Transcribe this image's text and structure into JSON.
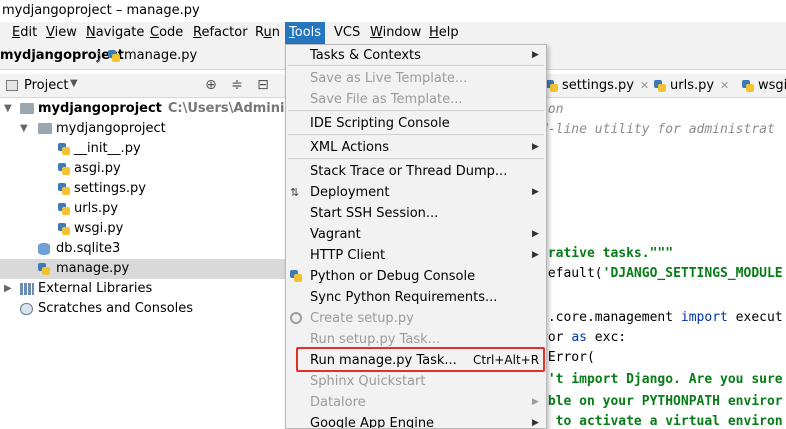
{
  "window": {
    "title": "mydjangoproject – manage.py"
  },
  "menu": [
    {
      "label": "Edit",
      "u": "E",
      "rest": "dit"
    },
    {
      "label": "View",
      "u": "V",
      "rest": "iew"
    },
    {
      "label": "Navigate",
      "u": "N",
      "rest": "avigate"
    },
    {
      "label": "Code",
      "u": "C",
      "rest": "ode"
    },
    {
      "label": "Refactor",
      "u": "R",
      "rest": "efactor"
    },
    {
      "label": "Run",
      "pre": "R",
      "u": "u",
      "rest": "n"
    },
    {
      "label": "Tools",
      "u": "T",
      "rest": "ools"
    },
    {
      "label": "VCS",
      "u": "",
      "rest": "VCS"
    },
    {
      "label": "Window",
      "u": "W",
      "rest": "indow"
    },
    {
      "label": "Help",
      "u": "H",
      "rest": "elp"
    }
  ],
  "breadcrumb": {
    "project": "mydjangoproject",
    "separator": "〉",
    "file": "manage.py"
  },
  "project_panel": {
    "title": "Project",
    "tree": [
      {
        "label": "mydjangoproject",
        "path": "C:\\Users\\Administrator",
        "icon": "folder-icon",
        "bold": true
      },
      {
        "label": "mydjangoproject",
        "icon": "folder-icon"
      },
      {
        "label": "__init__.py",
        "icon": "python-file-icon"
      },
      {
        "label": "asgi.py",
        "icon": "python-file-icon"
      },
      {
        "label": "settings.py",
        "icon": "python-file-icon"
      },
      {
        "label": "urls.py",
        "icon": "python-file-icon"
      },
      {
        "label": "wsgi.py",
        "icon": "python-file-icon"
      },
      {
        "label": "db.sqlite3",
        "icon": "database-icon"
      },
      {
        "label": "manage.py",
        "icon": "python-file-icon",
        "selected": true
      },
      {
        "label": "External Libraries",
        "icon": "library-icon"
      },
      {
        "label": "Scratches and Consoles",
        "icon": "scratches-icon"
      }
    ]
  },
  "tabs": [
    {
      "label": "settings.py"
    },
    {
      "label": "urls.py"
    },
    {
      "label": "wsgi"
    }
  ],
  "editor": {
    "lines": [
      {
        "parts": [
          [
            "cmt",
            "hon"
          ]
        ]
      },
      {
        "parts": [
          [
            "cmt",
            "d-line utility for administrat"
          ]
        ]
      },
      {
        "parts": [
          [
            "str",
            "trative tasks.\"\"\""
          ]
        ]
      },
      {
        "parts": [
          [
            "nrm",
            "default("
          ],
          [
            "str",
            "'DJANGO_SETTINGS_MODULE"
          ]
        ]
      },
      {
        "parts": [
          [
            "nrm",
            "o.core.management "
          ],
          [
            "kw",
            "import"
          ],
          [
            "nrm",
            " execut"
          ]
        ]
      },
      {
        "parts": [
          [
            "nrm",
            "ror "
          ],
          [
            "kw",
            "as"
          ],
          [
            "nrm",
            " exc:"
          ]
        ]
      },
      {
        "parts": [
          [
            "nrm",
            "tError("
          ]
        ]
      },
      {
        "parts": [
          [
            "str",
            "n't import Django. Are you sure"
          ]
        ]
      },
      {
        "parts": [
          [
            "str",
            "able on your PYTHONPATH enviror"
          ]
        ]
      },
      {
        "parts": [
          [
            "str",
            "t to activate a virtual environ"
          ]
        ]
      }
    ]
  },
  "tools_menu": [
    {
      "label": "Tasks & Contexts",
      "submenu": true
    },
    {
      "label": "Save as Live Template...",
      "disabled": true
    },
    {
      "label": "Save File as Template...",
      "disabled": true
    },
    {
      "label": "IDE Scripting Console"
    },
    {
      "label": "XML Actions",
      "submenu": true
    },
    {
      "label": "Stack Trace or Thread Dump..."
    },
    {
      "label": "Deployment",
      "submenu": true,
      "icon": "deployment-icon"
    },
    {
      "label": "Start SSH Session..."
    },
    {
      "label": "Vagrant",
      "submenu": true
    },
    {
      "label": "HTTP Client",
      "submenu": true
    },
    {
      "label": "Python or Debug Console",
      "icon": "python-console-icon"
    },
    {
      "label": "Sync Python Requirements..."
    },
    {
      "label": "Create setup.py",
      "disabled": true,
      "icon": "setup-icon"
    },
    {
      "label": "Run setup.py Task...",
      "disabled": true
    },
    {
      "label": "Run manage.py Task...",
      "shortcut": "Ctrl+Alt+R"
    },
    {
      "label": "Sphinx Quickstart",
      "disabled": true
    },
    {
      "label": "Datalore",
      "submenu": true,
      "disabled": true
    },
    {
      "label": "Google App Engine",
      "submenu": true
    }
  ],
  "colors": {
    "menu_active": "#2675bf",
    "highlight_box": "#e0312b",
    "selection": "#d9d9d9"
  }
}
